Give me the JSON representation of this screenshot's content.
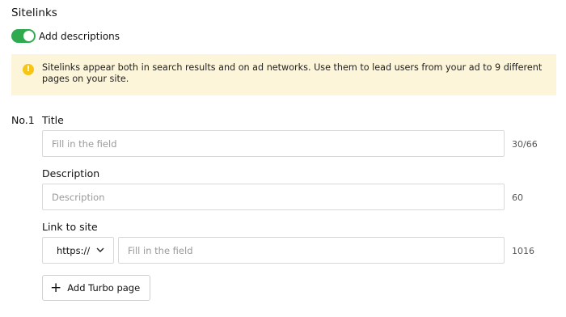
{
  "section": {
    "title": "Sitelinks"
  },
  "toggle": {
    "label": "Add descriptions",
    "on": true,
    "color": "#2faa4f"
  },
  "notice": {
    "icon": "warning-icon",
    "text": "Sitelinks appear both in search results and on ad networks. Use them to lead users from your ad to 9 different pages on your site."
  },
  "sitelink": {
    "number": "No.1",
    "title": {
      "label": "Title",
      "placeholder": "Fill in the field",
      "value": "",
      "counter": "30/66"
    },
    "description": {
      "label": "Description",
      "placeholder": "Description",
      "value": "",
      "counter": "60"
    },
    "link": {
      "label": "Link to site",
      "protocol": "https://",
      "placeholder": "Fill in the field",
      "value": "",
      "counter": "1016"
    },
    "turbo_button": "Add Turbo page"
  }
}
